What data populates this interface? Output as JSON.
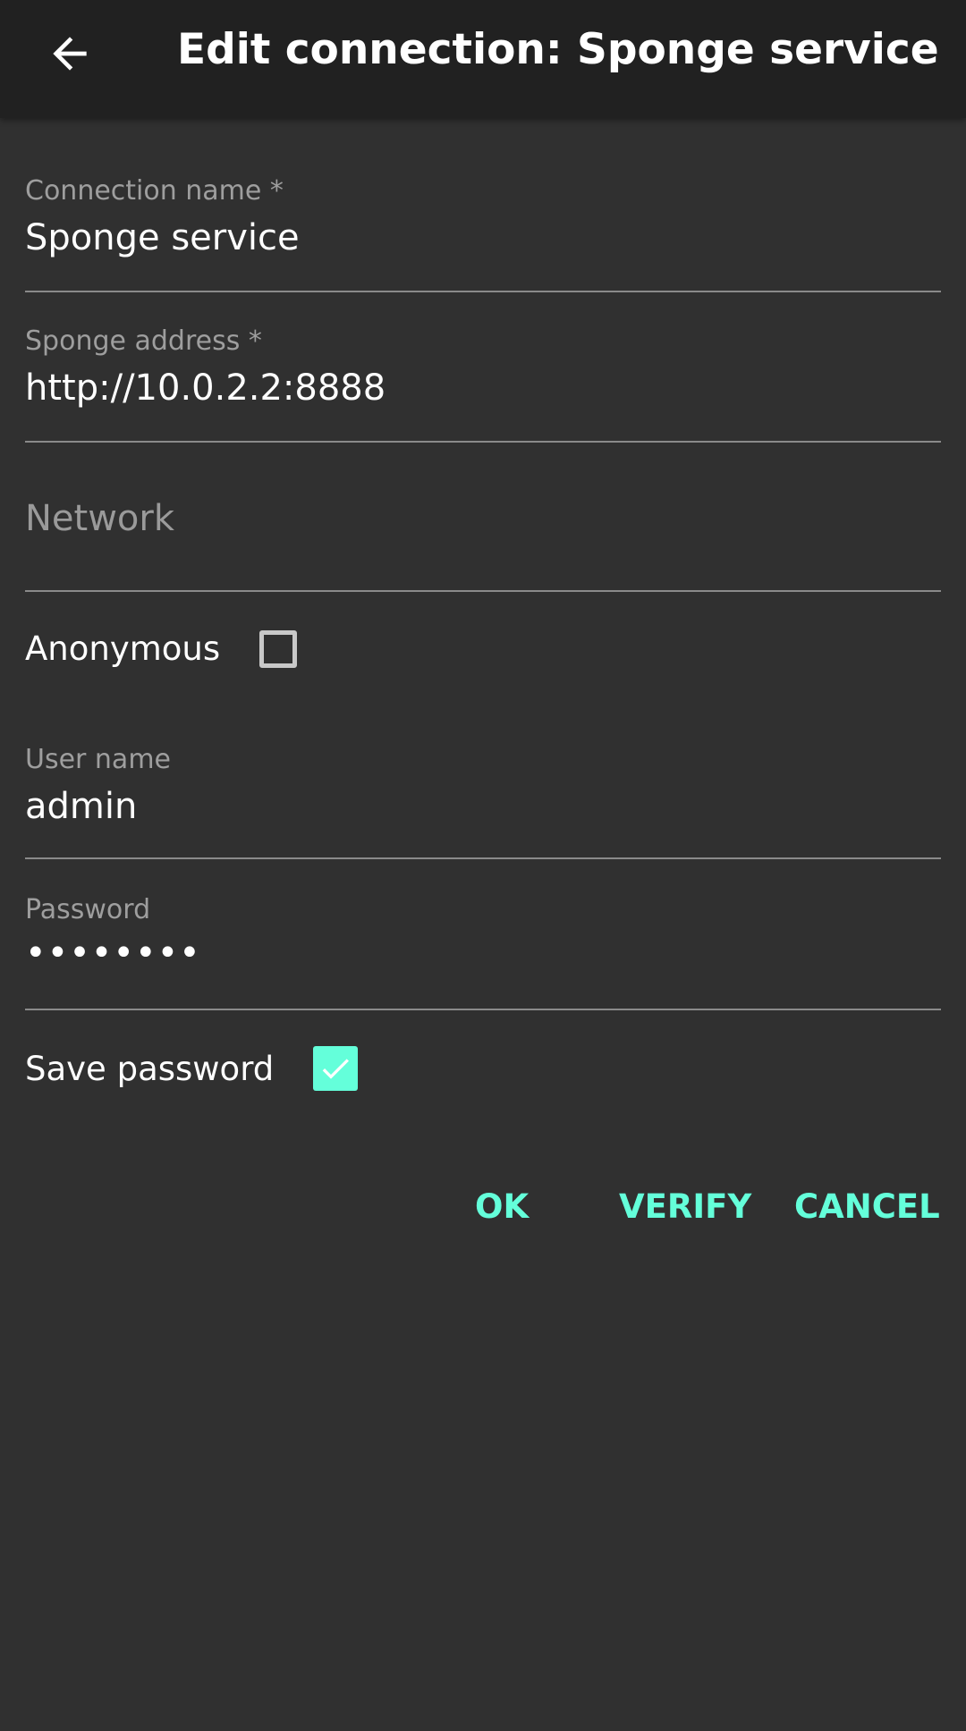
{
  "appbar": {
    "title": "Edit connection: Sponge service",
    "back_icon": "arrow-left-icon"
  },
  "form": {
    "connection_name": {
      "label": "Connection name *",
      "value": "Sponge service"
    },
    "sponge_address": {
      "label": "Sponge address *",
      "value": "http://10.0.2.2:8888"
    },
    "network": {
      "placeholder": "Network",
      "value": ""
    },
    "anonymous": {
      "label": "Anonymous",
      "checked": false
    },
    "user_name": {
      "label": "User name",
      "value": "admin"
    },
    "password": {
      "label": "Password",
      "value": "••••••••"
    },
    "save_password": {
      "label": "Save password",
      "checked": true
    }
  },
  "actions": {
    "ok_label": "OK",
    "verify_label": "VERIFY",
    "cancel_label": "CANCEL"
  },
  "colors": {
    "accent": "#64ffda",
    "background": "#303030",
    "appbar": "#212121"
  }
}
